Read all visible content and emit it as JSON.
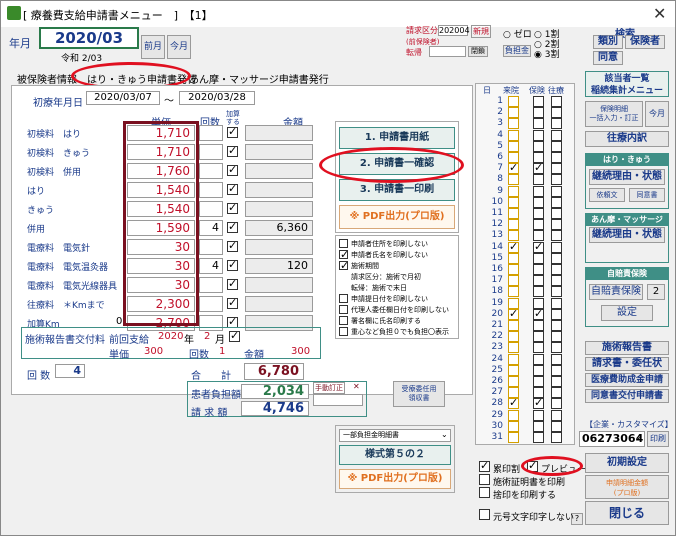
{
  "window": {
    "title": "[ 療養費支給申請書メニュー　]　【1】"
  },
  "header": {
    "year_month_label": "年月",
    "year_month_value": "2020/03",
    "prev_month": "前月",
    "this_month": "今月",
    "era_text": "令和 2/03",
    "insurance_label": "請求区分",
    "insurance_code": "202004",
    "new_badge": "新規",
    "prev_insurance_label": "(前保険者)",
    "transfer_label": "転帰",
    "close_btn": "閉鎖",
    "burden_label": "負担金",
    "radio_zero": "ゼロ",
    "radio_1": "1割",
    "radio_2": "2割",
    "radio_3": "3割"
  },
  "search": {
    "title": "検索",
    "category": "類別",
    "insurer": "保険者",
    "same": "同意"
  },
  "tabs": [
    "被保険者情報",
    "はり・きゅう申請書発行",
    "あん摩・マッサージ申請書発行"
  ],
  "dates": {
    "label": "初療年月日",
    "start": "2020/03/07",
    "tilde": "〜",
    "end": "2020/03/28"
  },
  "grid_headers": {
    "unit": "単価",
    "times": "回数",
    "add": "加算\nする",
    "amount": "金額"
  },
  "rows": [
    {
      "cat": "初検料",
      "sub": "はり",
      "price": "1,710",
      "times": "",
      "checked": true,
      "amount": ""
    },
    {
      "cat": "初検料",
      "sub": "きゅう",
      "price": "1,710",
      "times": "",
      "checked": true,
      "amount": ""
    },
    {
      "cat": "初検料",
      "sub": "併用",
      "price": "1,760",
      "times": "",
      "checked": true,
      "amount": ""
    },
    {
      "cat": "はり",
      "sub": "",
      "price": "1,540",
      "times": "",
      "checked": true,
      "amount": ""
    },
    {
      "cat": "きゅう",
      "sub": "",
      "price": "1,540",
      "times": "",
      "checked": true,
      "amount": ""
    },
    {
      "cat": "併用",
      "sub": "",
      "price": "1,590",
      "times": "4",
      "checked": true,
      "amount": "6,360"
    },
    {
      "cat": "電療料",
      "sub": "電気針",
      "price": "30",
      "times": "",
      "checked": true,
      "amount": ""
    },
    {
      "cat": "電療料",
      "sub": "電気温灸器",
      "price": "30",
      "times": "4",
      "checked": true,
      "amount": "120"
    },
    {
      "cat": "電療料",
      "sub": "電気光線器具",
      "price": "30",
      "times": "",
      "checked": true,
      "amount": ""
    },
    {
      "cat": "往療料",
      "sub": "＊Kmまで",
      "price": "2,300",
      "times": "",
      "checked": true,
      "amount": ""
    },
    {
      "cat": "加算Km",
      "sub": "",
      "price": "2,700",
      "times": "",
      "checked": true,
      "amount": "",
      "zero": "0"
    }
  ],
  "report": {
    "label": "施術報告書交付料",
    "prev_label": "前回支給",
    "year": "2020",
    "year_unit": "年",
    "month": "2",
    "month_unit": "月",
    "unit_label": "単価",
    "unit_value": "300",
    "times_label": "回数",
    "times_value": "1",
    "amount_label": "金額",
    "amount_value": "300"
  },
  "totals": {
    "count_label": "回 数",
    "count_value": "4",
    "total_label": "合　　計",
    "total_value": "6,780",
    "patient_label": "患者負担額",
    "patient_value": "2,034",
    "manual_fix": "手動訂正",
    "claim_label": "請 求 額",
    "claim_value": "4,746",
    "receipt_btn": "受療委任用\n領収書"
  },
  "steps": {
    "step1": "1. 申請書用紙",
    "step2": "2. 申請書一確認",
    "step3": "3. 申請書一印刷",
    "pdf": "※ PDF出力(プロ版)"
  },
  "print_opts": [
    {
      "label": "申請者住所を印刷しない",
      "checked": false
    },
    {
      "label": "申請者氏名を印刷しない",
      "checked": true
    },
    {
      "label": "施術期間",
      "checked": true
    },
    {
      "label": "請求区分：施術で月初",
      "checked": false,
      "note": true
    },
    {
      "label": "転帰：施術で末日",
      "checked": false,
      "note": true
    },
    {
      "label": "申請提日付を印刷しない",
      "checked": false
    },
    {
      "label": "代理人委任欄日付を印刷しない",
      "checked": false
    },
    {
      "label": "署名欄に氏名印刷する",
      "checked": false
    },
    {
      "label": "重心など負担０でも負担〇表示",
      "checked": false
    }
  ],
  "format_panel": {
    "select": "一部負担金明細書",
    "form_btn": "様式第５の２",
    "pdf": "※ PDF出力(プロ版)"
  },
  "days": {
    "headers": [
      "日",
      "来院",
      "保険",
      "往療"
    ],
    "list": [
      "1",
      "2",
      "3",
      "4",
      "5",
      "6",
      "7",
      "8",
      "9",
      "10",
      "11",
      "12",
      "13",
      "14",
      "15",
      "16",
      "17",
      "18",
      "19",
      "20",
      "21",
      "22",
      "23",
      "24",
      "25",
      "26",
      "27",
      "28",
      "29",
      "30",
      "31"
    ],
    "visits": [
      7,
      14,
      20,
      28
    ]
  },
  "right_panel": {
    "applicant_list": "該当者一覧",
    "summary_menu": "稲続集計メニュー",
    "insurance_detail": "保険明細\n一括入力・訂正",
    "this_month": "今月",
    "history": "往療内訳",
    "hari_group": "はり・きゅう",
    "continuation": "継続理由・状態",
    "consent_ask": "依頼文",
    "consent_doc": "同意書",
    "anma_group": "あん摩・マッサージ",
    "anma_continuation": "継続理由・状態",
    "self_group": "自賠責保険",
    "self_pay": "自賠責保険",
    "self_num": "2",
    "settings": "設定",
    "report": "施術報告書",
    "claim_proxy": "請求書・委任状",
    "medical_apply": "医療費助成金申請",
    "consent_apply": "同意書交付申請書",
    "company_label": "【企業・カスタマイズ】",
    "company_code": "06273064",
    "print": "印刷",
    "init_settings": "初期設定",
    "detail_pro": "申請明細金額\n(プロ版)",
    "close": "閉じる",
    "help": "?"
  },
  "bottom_opts": {
    "stamp": "累印割",
    "preview": "プレビュー",
    "receipt_print": "施術証明書を印刷",
    "stamp_print": "捨印を印刷する",
    "original_text": "元号文字印字しない"
  }
}
